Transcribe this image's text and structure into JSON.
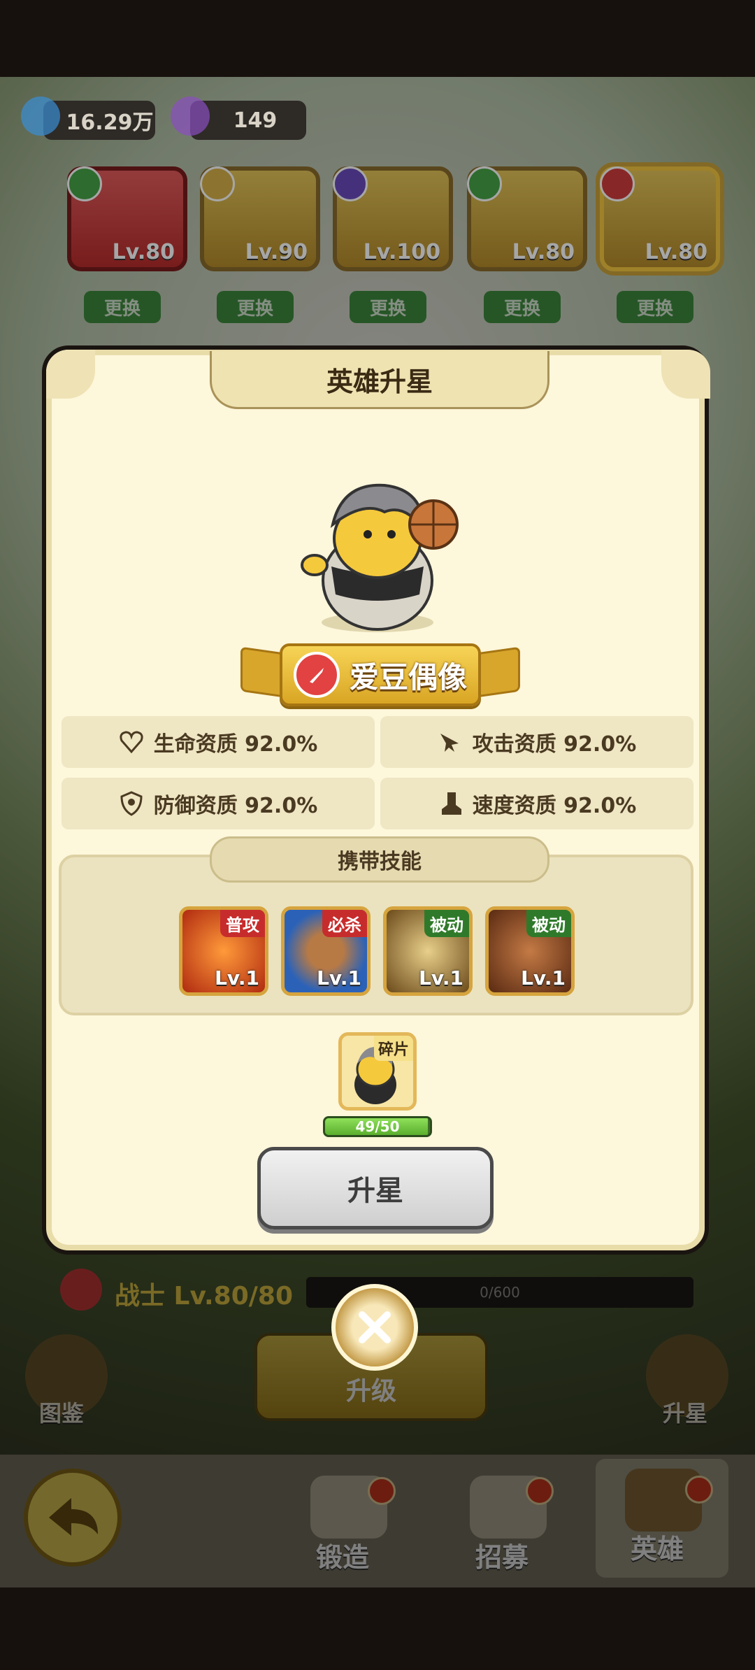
{
  "currencies": [
    {
      "name": "water-drop",
      "value": "16.29万",
      "color": "#3a8fd6"
    },
    {
      "name": "purple-gem",
      "value": "149",
      "color": "#8a4fc0"
    }
  ],
  "hero_slots": [
    {
      "level": "Lv.80",
      "change": "更换",
      "theme": "red"
    },
    {
      "level": "Lv.90",
      "change": "更换",
      "theme": "gold"
    },
    {
      "level": "Lv.100",
      "change": "更换",
      "theme": "gold"
    },
    {
      "level": "Lv.80",
      "change": "更换",
      "theme": "gold"
    },
    {
      "level": "Lv.80",
      "change": "更换",
      "theme": "gold"
    }
  ],
  "modal": {
    "title": "英雄升星",
    "hero_name": "爱豆偶像",
    "stats": [
      {
        "icon": "heart-icon",
        "label": "生命资质 92.0%"
      },
      {
        "icon": "attack-icon",
        "label": "攻击资质 92.0%"
      },
      {
        "icon": "shield-icon",
        "label": "防御资质 92.0%"
      },
      {
        "icon": "boot-icon",
        "label": "速度资质 92.0%"
      }
    ],
    "skills_title": "携带技能",
    "skills": [
      {
        "tag": "普攻",
        "level": "Lv.1",
        "tag_color": "#c72c2c",
        "bg": "#c9421c"
      },
      {
        "tag": "必杀",
        "level": "Lv.1",
        "tag_color": "#c72c2c",
        "bg": "#2b62b8"
      },
      {
        "tag": "被动",
        "level": "Lv.1",
        "tag_color": "#2f7a2a",
        "bg": "#6b4a1a"
      },
      {
        "tag": "被动",
        "level": "Lv.1",
        "tag_color": "#2f7a2a",
        "bg": "#7a3e1c"
      }
    ],
    "fragment_tag": "碎片",
    "fragment_progress_text": "49/50",
    "fragment_progress": 0.98,
    "star_button": "升星"
  },
  "under": {
    "class_label": "战士 Lv.80/80",
    "xp_text": "0/600",
    "codex_label": "图鉴",
    "upgrade_label": "升级",
    "ascend_label": "升星"
  },
  "nav": {
    "forge": "锻造",
    "recruit": "招募",
    "hero": "英雄"
  }
}
